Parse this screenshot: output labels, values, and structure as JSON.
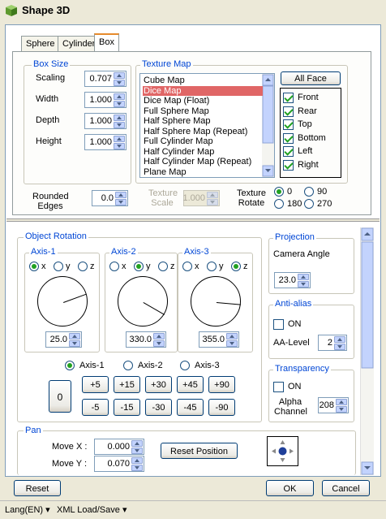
{
  "window": {
    "title": "Shape 3D"
  },
  "tabs": [
    {
      "label": "Sphere"
    },
    {
      "label": "Cylinder"
    },
    {
      "label": "Box"
    }
  ],
  "box_size": {
    "legend": "Box Size",
    "scaling_label": "Scaling",
    "scaling": "0.707",
    "width_label": "Width",
    "width": "1.000",
    "depth_label": "Depth",
    "depth": "1.000",
    "height_label": "Height",
    "height": "1.000"
  },
  "rounded_edges": {
    "label_line1": "Rounded",
    "label_line2": "Edges",
    "value": "0.0"
  },
  "texture_map": {
    "legend": "Texture Map",
    "items": [
      "Cube Map",
      "Dice Map",
      "Dice Map (Float)",
      "Full Sphere Map",
      "Half Sphere Map",
      "Half Sphere Map (Repeat)",
      "Full Cylinder Map",
      "Half Cylinder Map",
      "Half Cylinder Map (Repeat)",
      "Plane Map"
    ],
    "selected_index": 1
  },
  "all_face": {
    "label": "All Face"
  },
  "faces": [
    {
      "label": "Front",
      "checked": true
    },
    {
      "label": "Rear",
      "checked": true
    },
    {
      "label": "Top",
      "checked": true
    },
    {
      "label": "Bottom",
      "checked": true
    },
    {
      "label": "Left",
      "checked": true
    },
    {
      "label": "Right",
      "checked": true
    }
  ],
  "texture_scale": {
    "line1": "Texture",
    "line2": "Scale",
    "value": "1.000"
  },
  "texture_rotate": {
    "line1": "Texture",
    "line2": "Rotate",
    "options": [
      "0",
      "90",
      "180",
      "270"
    ],
    "selected": "0"
  },
  "object_rotation": {
    "legend": "Object Rotation",
    "axes": [
      {
        "title": "Axis-1",
        "selected": "x",
        "value": "25.0",
        "angle": -20
      },
      {
        "title": "Axis-2",
        "selected": "y",
        "value": "330.0",
        "angle": 30
      },
      {
        "title": "Axis-3",
        "selected": "z",
        "value": "355.0",
        "angle": 5
      }
    ],
    "axis_labels": [
      "x",
      "y",
      "z"
    ],
    "axis_select": [
      "Axis-1",
      "Axis-2",
      "Axis-3"
    ],
    "axis_selected": "Axis-1",
    "zero_label": "0",
    "inc_buttons": [
      "+5",
      "+15",
      "+30",
      "+45",
      "+90"
    ],
    "dec_buttons": [
      "-5",
      "-15",
      "-30",
      "-45",
      "-90"
    ]
  },
  "projection": {
    "legend": "Projection",
    "camera_label": "Camera Angle",
    "camera_value": "23.0"
  },
  "anti_alias": {
    "legend": "Anti-alias",
    "on_label": "ON",
    "level_label": "AA-Level",
    "level": "2"
  },
  "transparency": {
    "legend": "Transparency",
    "on_label": "ON",
    "alpha_line1": "Alpha",
    "alpha_line2": "Channel",
    "alpha": "208"
  },
  "pan": {
    "legend": "Pan",
    "move_x_label": "Move X :",
    "move_x": "0.000",
    "move_y_label": "Move Y :",
    "move_y": "0.070",
    "reset_label": "Reset Position"
  },
  "footer": {
    "reset": "Reset",
    "ok": "OK",
    "cancel": "Cancel"
  },
  "statusbar": {
    "lang": "Lang(EN)",
    "xml": "XML Load/Save"
  }
}
